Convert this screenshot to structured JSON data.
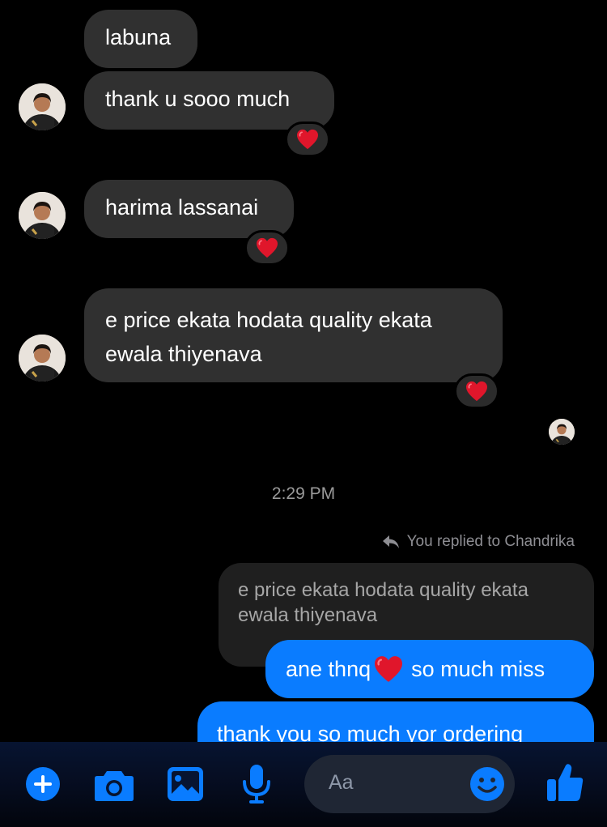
{
  "messages": [
    {
      "text": "labuna"
    },
    {
      "text": "thank u sooo much",
      "reaction": "heart"
    },
    {
      "text": "harima lassanai",
      "reaction": "heart"
    },
    {
      "line1": "e price ekata hodata quality ekata",
      "line2": "ewala thiyenava",
      "reaction": "heart"
    }
  ],
  "timestamp": "2:29 PM",
  "reply": {
    "label": "You replied to Chandrika",
    "quoted_line1": "e price ekata hodata quality ekata",
    "quoted_line2": "ewala thiyenava"
  },
  "sent": [
    {
      "text_before": "ane thnq",
      "emoji": "heart",
      "text_after": "so much miss"
    },
    {
      "text": "thank you so much yor ordering"
    }
  ],
  "composer": {
    "placeholder": "Aa",
    "icons": [
      "plus-icon",
      "camera-icon",
      "image-icon",
      "mic-icon",
      "emoji-icon",
      "thumbs-up-icon"
    ]
  },
  "colors": {
    "incoming_bubble": "#303030",
    "outgoing_bubble": "#0a7cff",
    "composer_accent": "#0a7cff",
    "reaction_heart": "#e0162b"
  }
}
